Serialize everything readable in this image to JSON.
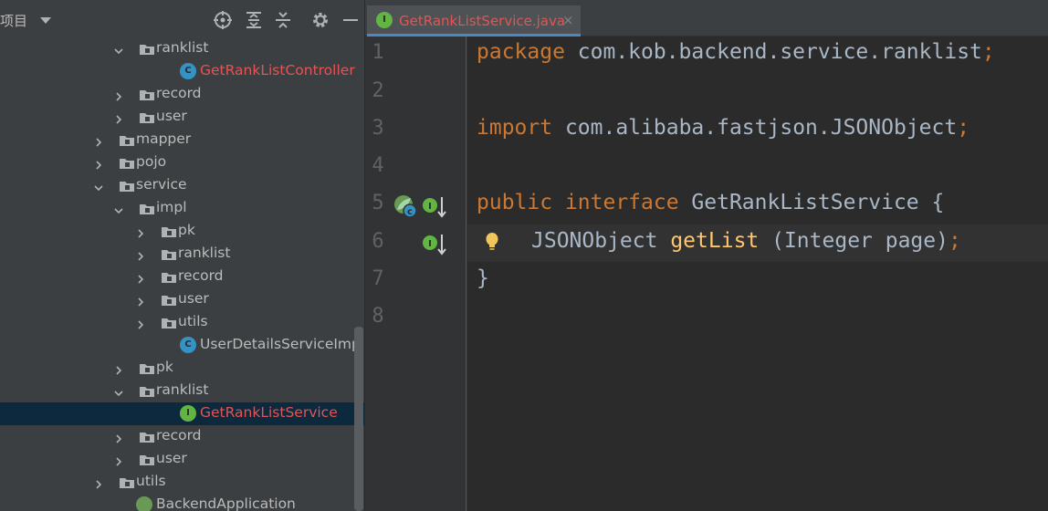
{
  "project_panel": {
    "title": "项目",
    "tree": [
      {
        "label": "ranklist",
        "type": "folder",
        "expanded": true
      },
      {
        "label": "GetRankListController",
        "type": "class",
        "status": "modified"
      },
      {
        "label": "record",
        "type": "folder",
        "expanded": false
      },
      {
        "label": "user",
        "type": "folder",
        "expanded": false
      },
      {
        "label": "mapper",
        "type": "folder",
        "expanded": false
      },
      {
        "label": "pojo",
        "type": "folder",
        "expanded": false
      },
      {
        "label": "service",
        "type": "folder",
        "expanded": true
      },
      {
        "label": "impl",
        "type": "folder",
        "expanded": true
      },
      {
        "label": "pk",
        "type": "folder",
        "expanded": false
      },
      {
        "label": "ranklist",
        "type": "folder",
        "expanded": false
      },
      {
        "label": "record",
        "type": "folder",
        "expanded": false
      },
      {
        "label": "user",
        "type": "folder",
        "expanded": false
      },
      {
        "label": "utils",
        "type": "folder",
        "expanded": false
      },
      {
        "label": "UserDetailsServiceImpl",
        "type": "class"
      },
      {
        "label": "pk",
        "type": "folder",
        "expanded": false
      },
      {
        "label": "ranklist",
        "type": "folder",
        "expanded": true
      },
      {
        "label": "GetRankListService",
        "type": "interface",
        "status": "modified",
        "selected": true
      },
      {
        "label": "record",
        "type": "folder",
        "expanded": false
      },
      {
        "label": "user",
        "type": "folder",
        "expanded": false
      },
      {
        "label": "utils",
        "type": "folder",
        "expanded": false
      },
      {
        "label": "BackendApplication",
        "type": "spring-class"
      }
    ]
  },
  "editor": {
    "tab": {
      "label": "GetRankListService.java",
      "close": "×"
    },
    "line_numbers": [
      "1",
      "2",
      "3",
      "4",
      "5",
      "6",
      "7",
      "8"
    ],
    "code": {
      "l1_kw": "package",
      "l1_rest": " com.kob.backend.service.ranklist",
      "l1_semi": ";",
      "l3_kw": "import",
      "l3_rest": " com.alibaba.fastjson.JSONObject",
      "l3_semi": ";",
      "l5_kw": "public interface",
      "l5_rest": " GetRankListService {",
      "l6_type": "JSONObject ",
      "l6_fn": "getList",
      "l6_rest": " (Integer page)",
      "l6_semi": ";",
      "l7": "}"
    }
  },
  "colors": {
    "panel_bg": "#3c3f41",
    "editor_bg": "#2b2b2b",
    "keyword": "#cc7832",
    "method": "#ffc66d",
    "modified_file": "#e05555",
    "class_icon": "#3592c4",
    "interface_icon": "#62b543",
    "selection": "#0d293e"
  },
  "icons": {
    "header": [
      "locate-icon",
      "expand-all-icon",
      "collapse-all-icon",
      "gear-icon",
      "minimize-icon"
    ],
    "gutter": [
      "spring-bean-icon",
      "implemented-interface-icon",
      "lightbulb-icon"
    ]
  }
}
